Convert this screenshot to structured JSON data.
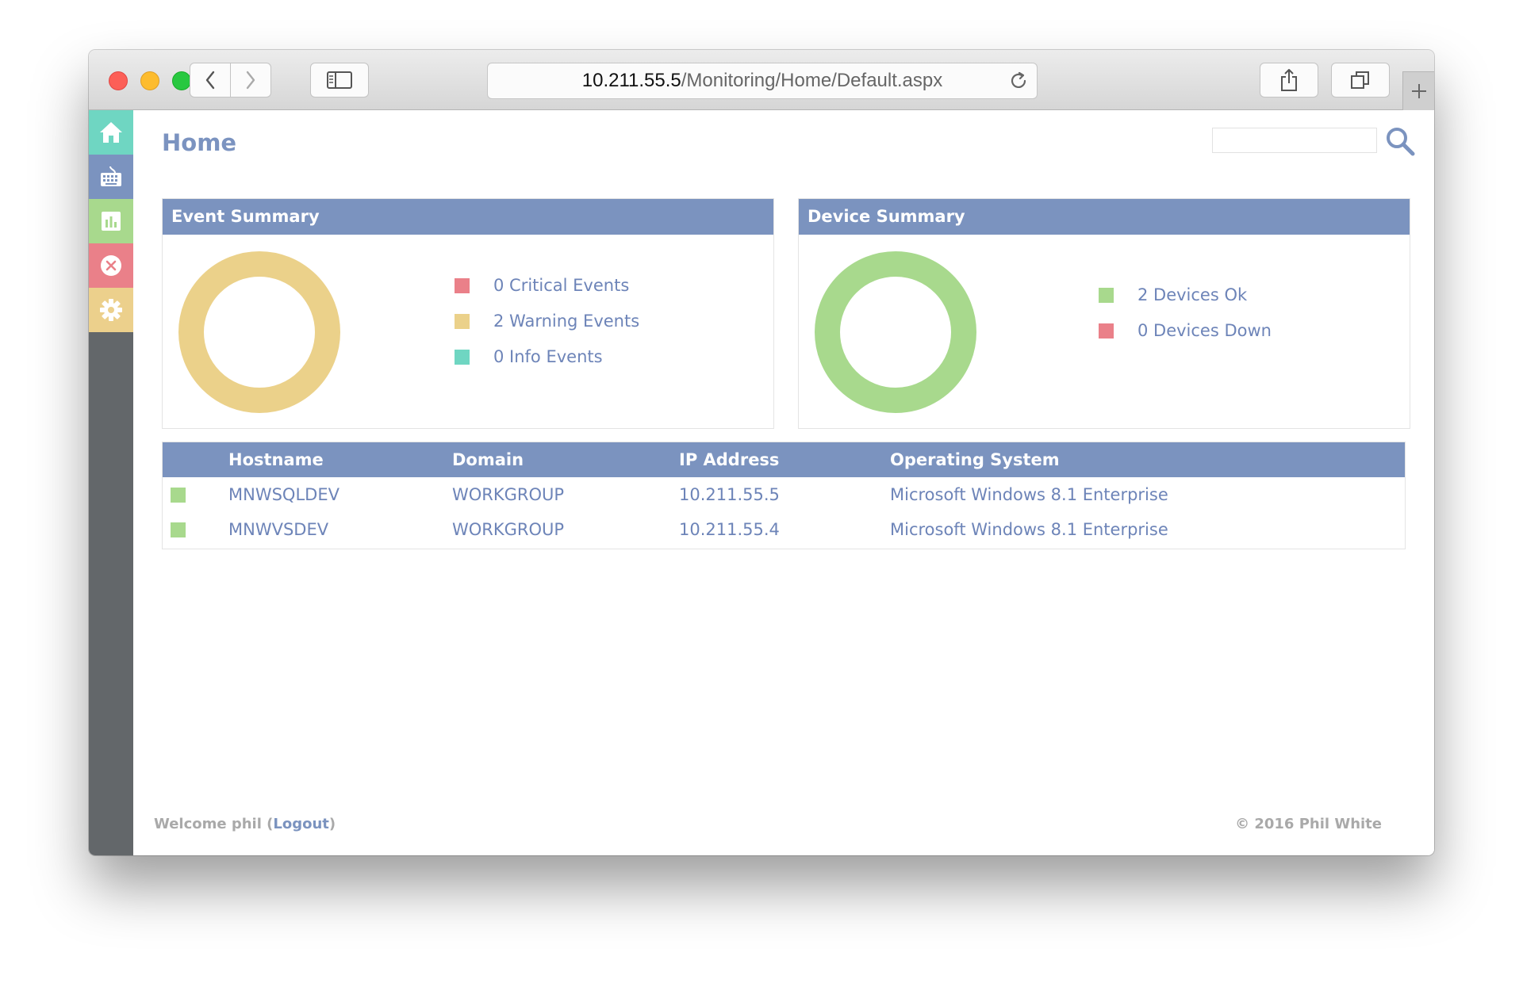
{
  "browser": {
    "address_host": "10.211.55.5",
    "address_path": "/Monitoring/Home/Default.aspx"
  },
  "sidebar": {
    "items": [
      {
        "name": "home",
        "icon": "home-icon",
        "color": "#6fd6c2"
      },
      {
        "name": "devices",
        "icon": "keyboard-icon",
        "color": "#7b93bf"
      },
      {
        "name": "reports",
        "icon": "bar-chart-icon",
        "color": "#a8d98d"
      },
      {
        "name": "errors",
        "icon": "close-circle-icon",
        "color": "#ea8089"
      },
      {
        "name": "settings",
        "icon": "gear-icon",
        "color": "#ecd08c"
      }
    ]
  },
  "header": {
    "title": "Home",
    "search_placeholder": ""
  },
  "event_summary": {
    "title": "Event Summary",
    "donut_color": "#ebd18a",
    "legend": [
      {
        "label": "0 Critical Events",
        "count": 0,
        "color": "#ea8089"
      },
      {
        "label": "2 Warning Events",
        "count": 2,
        "color": "#ebd18a"
      },
      {
        "label": "0 Info Events",
        "count": 0,
        "color": "#6fd6c2"
      }
    ]
  },
  "device_summary": {
    "title": "Device Summary",
    "donut_color": "#a8d98d",
    "legend": [
      {
        "label": "2 Devices Ok",
        "count": 2,
        "color": "#a8d98d"
      },
      {
        "label": "0 Devices Down",
        "count": 0,
        "color": "#ea8089"
      }
    ]
  },
  "devices_table": {
    "columns": [
      "Hostname",
      "Domain",
      "IP Address",
      "Operating System"
    ],
    "rows": [
      {
        "status": "ok",
        "hostname": "MNWSQLDEV",
        "domain": "WORKGROUP",
        "ip": "10.211.55.5",
        "os": "Microsoft Windows 8.1 Enterprise"
      },
      {
        "status": "ok",
        "hostname": "MNWVSDEV",
        "domain": "WORKGROUP",
        "ip": "10.211.55.4",
        "os": "Microsoft Windows 8.1 Enterprise"
      }
    ]
  },
  "footer": {
    "welcome": "Welcome phil (",
    "logout": "Logout",
    "welcome_end": ")",
    "copyright": "© 2016 Phil White"
  }
}
